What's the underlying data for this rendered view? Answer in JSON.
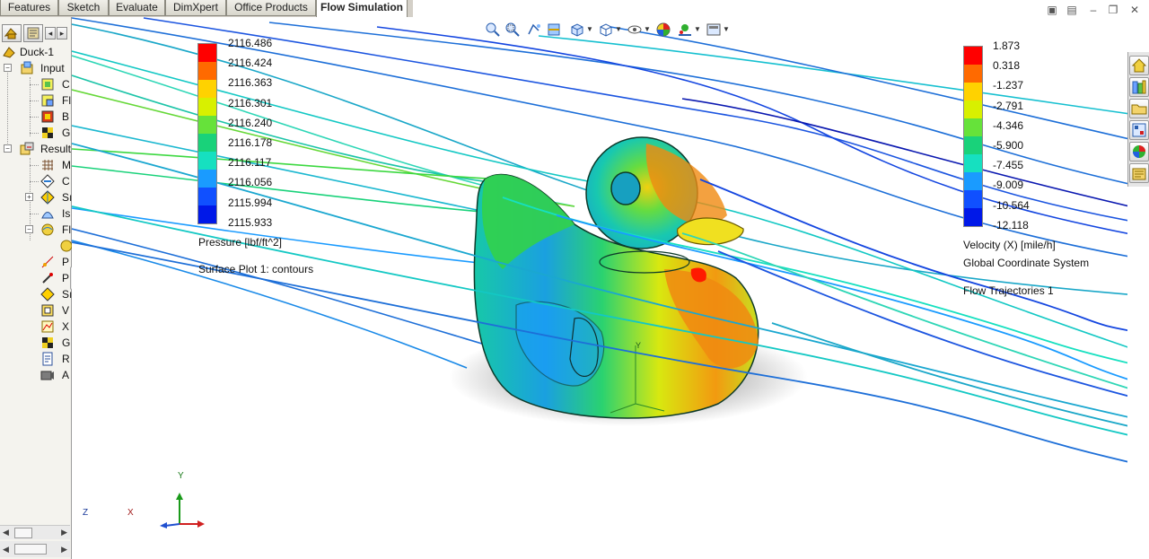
{
  "tabs": [
    {
      "label": "Features",
      "active": false
    },
    {
      "label": "Sketch",
      "active": false
    },
    {
      "label": "Evaluate",
      "active": false
    },
    {
      "label": "DimXpert",
      "active": false
    },
    {
      "label": "Office Products",
      "active": false
    },
    {
      "label": "Flow Simulation",
      "active": true
    }
  ],
  "tree": {
    "root": "Duck-1",
    "input": "Input",
    "input_items": [
      "C",
      "Fl",
      "B",
      "G"
    ],
    "results": "Result",
    "results_items": [
      "M",
      "C",
      "Sı",
      "Is",
      "Fl"
    ],
    "lower_items": [
      "P",
      "P",
      "Sı",
      "V",
      "X",
      "G",
      "R",
      "A"
    ]
  },
  "pressure_legend": {
    "values": [
      "2116.486",
      "2116.424",
      "2116.363",
      "2116.301",
      "2116.240",
      "2116.178",
      "2116.117",
      "2116.056",
      "2115.994",
      "2115.933"
    ],
    "colors": [
      "#ff0000",
      "#ff6a00",
      "#ffd200",
      "#d8f000",
      "#66e23a",
      "#19d27a",
      "#16e0c0",
      "#1a9bff",
      "#1050ff",
      "#0018e8"
    ],
    "title": "Pressure [lbf/ft^2]",
    "plot_name": "Surface Plot 1: contours"
  },
  "velocity_legend": {
    "values": [
      "1.873",
      "0.318",
      "-1.237",
      "-2.791",
      "-4.346",
      "-5.900",
      "-7.455",
      "-9.009",
      "-10.564",
      "-12.118"
    ],
    "colors": [
      "#ff0000",
      "#ff6a00",
      "#ffd200",
      "#d8f000",
      "#66e23a",
      "#19d27a",
      "#16e0c0",
      "#1a9bff",
      "#1050ff",
      "#0018e8"
    ],
    "title": "Velocity (X) [mile/h]",
    "coord_system": "Global Coordinate System",
    "trajectories": "Flow Trajectories 1"
  },
  "triad": {
    "x": "X",
    "y": "Y",
    "z": "Z"
  },
  "icons": {
    "hud": [
      "zoom-to-fit-icon",
      "zoom-to-area-icon",
      "previous-view-icon",
      "section-view-icon",
      "view-orientation-icon",
      "display-style-icon",
      "hide-show-items-icon",
      "edit-appearance-icon",
      "apply-scene-icon",
      "view-settings-icon"
    ],
    "taskpane": [
      "resources-home-icon",
      "design-library-icon",
      "file-explorer-icon",
      "view-palette-icon",
      "appearances-icon",
      "custom-properties-icon"
    ]
  }
}
